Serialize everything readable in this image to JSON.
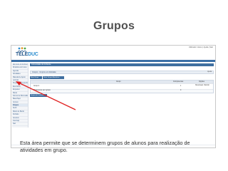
{
  "slide": {
    "title": "Grupos",
    "caption": "Esta área permite que se determinem grupos de alunos para realização de atividades em grupo."
  },
  "screenshot": {
    "logo": {
      "text_main": "TELE",
      "text_accent": "DUC"
    },
    "user_bar": "Utilizador: Aluno | Ajuda | Sair",
    "panel_title": "Comunidade do Ambiente",
    "breadcrumb": "Grupos - Grupos em Atividade",
    "breadcrumb_right": "Ajuda",
    "buttons": {
      "new_group": "Novo Grupo",
      "create_groups": "Gerar Grupos Aleatórios",
      "bottom": "Grupos de Trabalho"
    },
    "sidebar_items": [
      "Estrutura do Ambiente",
      "Dinâmica do Curso",
      "Agenda",
      "Atividades",
      "Material de Apoio",
      "Leituras",
      "Perguntas Frequentes",
      "Exercícios",
      "Enquetes",
      "Mural",
      "Fóruns de Discussão",
      "Bate-Papo",
      "Correio",
      "Grupos",
      "Perfil",
      "Diário de Bordo",
      "Portfolio",
      "Acessos",
      "Intermap",
      "Sair"
    ],
    "active_sidebar_index": 13,
    "table": {
      "headers": [
        "Grupo",
        "Componentes",
        "Opções"
      ],
      "rows": [
        {
          "name": "Grupo 1",
          "count": "1",
          "options": "Renomear / Excluir"
        },
        {
          "name": "Professores sem grupo",
          "count": "0",
          "options": ""
        }
      ]
    },
    "accent_color": "#3f6fa0",
    "annotation_color": "#e02020"
  }
}
